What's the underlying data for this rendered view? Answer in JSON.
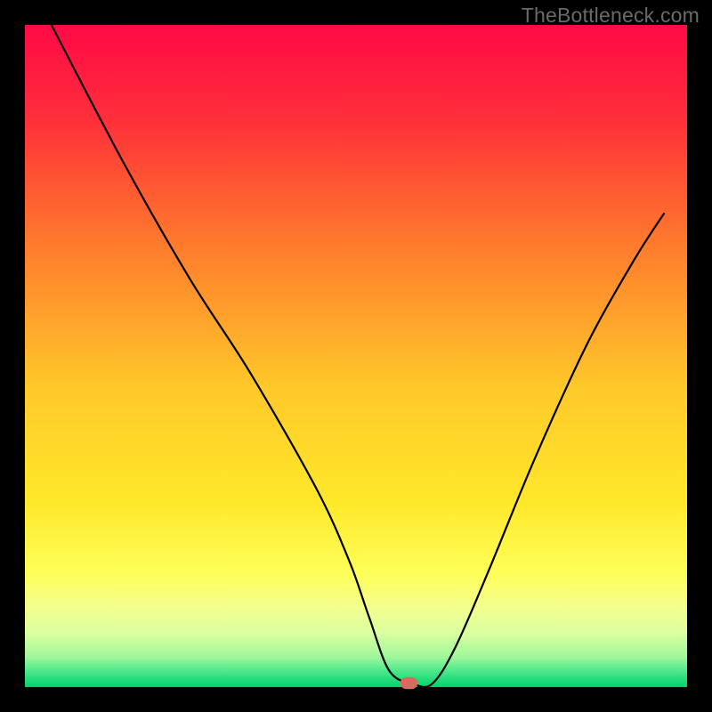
{
  "watermark": "TheBottleneck.com",
  "chart_data": {
    "type": "line",
    "title": "",
    "xlabel": "",
    "ylabel": "",
    "xlim": [
      0,
      100
    ],
    "ylim": [
      0,
      100
    ],
    "grid": false,
    "legend": false,
    "background_gradient": {
      "top_color": "#ff0a46",
      "mid_color": "#ffde2a",
      "green_band_top": "#f7ff9a",
      "bottom_color": "#00d36b"
    },
    "series": [
      {
        "name": "curve",
        "x": [
          4.0,
          15.0,
          25.0,
          34.0,
          44.0,
          49.0,
          52.0,
          55.0,
          58.5,
          61.5,
          65.0,
          70.0,
          77.0,
          85.0,
          92.0,
          96.5
        ],
        "values": [
          100.0,
          79.0,
          61.5,
          47.5,
          30.0,
          19.0,
          10.5,
          2.5,
          0.5,
          0.5,
          6.0,
          17.5,
          34.5,
          52.0,
          64.5,
          71.5
        ]
      }
    ],
    "marker": {
      "name": "minimum-marker",
      "x": 58.0,
      "y": 0.6,
      "rx_pct": 1.3,
      "ry_pct": 0.9,
      "fill": "#d86a5f"
    },
    "plot_area_inset": {
      "left": 3.5,
      "right": 3.5,
      "top": 3.5,
      "bottom": 3.5
    }
  }
}
